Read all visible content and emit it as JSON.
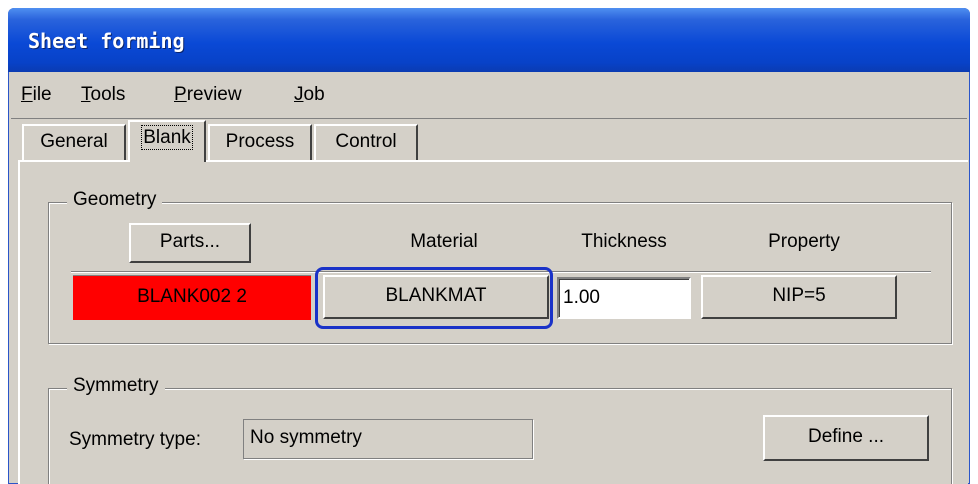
{
  "window": {
    "title": "Sheet forming"
  },
  "menu": [
    "File",
    "Tools",
    "Preview",
    "Job"
  ],
  "tabs": [
    "General",
    "Blank",
    "Process",
    "Control"
  ],
  "active_tab": "Blank",
  "geometry": {
    "group_label": "Geometry",
    "parts_button": "Parts...",
    "columns": {
      "material": "Material",
      "thickness": "Thickness",
      "property": "Property"
    },
    "row": {
      "part": "BLANK002    2",
      "material": "BLANKMAT",
      "thickness": "1.00",
      "property": "NIP=5"
    }
  },
  "symmetry": {
    "group_label": "Symmetry",
    "type_label": "Symmetry type:",
    "type_value": "No symmetry",
    "define_button": "Define ..."
  },
  "colors": {
    "title_bar": "#0a49d6",
    "part_cell": "#ff0000",
    "highlight": "#1a32c8",
    "dialog_bg": "#d4d0c8"
  }
}
